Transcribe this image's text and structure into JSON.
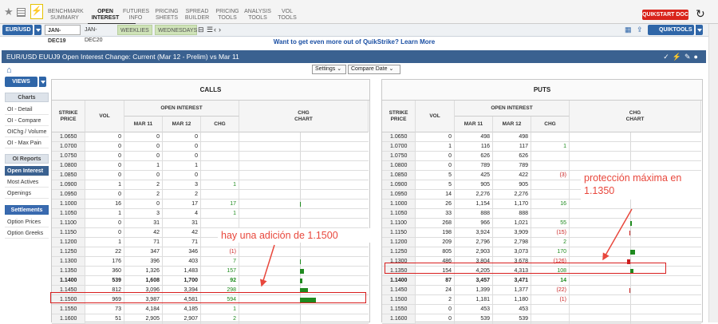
{
  "top": {
    "nav": [
      {
        "label": "BENCHMARK\nSUMMARY",
        "active": false
      },
      {
        "label": "OPEN\nINTEREST",
        "active": true
      },
      {
        "label": "FUTURES\nINFO",
        "active": false
      },
      {
        "label": "PRICING\nSHEETS",
        "active": false
      },
      {
        "label": "SPREAD\nBUILDER",
        "active": false
      },
      {
        "label": "PRICING\nTOOLS",
        "active": false
      },
      {
        "label": "ANALYSIS\nTOOLS",
        "active": false
      },
      {
        "label": "VOL\nTOOLS",
        "active": false
      }
    ],
    "quickstart": "QUIKSTART DOC"
  },
  "toolbar": {
    "product": "EUR/USD",
    "tabs": [
      {
        "label": "JAN-DEC19",
        "style": "on"
      },
      {
        "label": "JAN-DEC20",
        "style": "plain"
      },
      {
        "label": "WEEKLIES",
        "style": "green"
      },
      {
        "label": "WEDNESDAYS",
        "style": "green"
      }
    ],
    "quicktools": "QUIKTOOLS"
  },
  "promo": "Want to get even more out of QuikStrike? Learn More",
  "banner": "EUR/USD EUUJ9 Open Interest Change: Current (Mar 12 - Prelim) vs Mar 11",
  "controls": {
    "settings": "Settings",
    "compare": "Compare Date"
  },
  "sidebar": {
    "views": "VIEWS",
    "charts_header": "Charts",
    "charts": [
      "OI - Detail",
      "OI - Compare",
      "OIChg / Volume",
      "OI - Max Pain"
    ],
    "reports_header": "OI Reports",
    "reports": [
      "Open Interest",
      "Most Actives",
      "Openings"
    ],
    "settlements_header": "Settlements",
    "settlements": [
      "Option Prices",
      "Option Greeks"
    ],
    "selected": "Open Interest"
  },
  "colors": {
    "positive": "#1d8a1d",
    "negative": "#c81e1e",
    "bar": "#1f8a1f",
    "highlight": "#d81e1e",
    "annotation": "#e8473c"
  },
  "calls": {
    "title": "CALLS",
    "headers": {
      "strike": "STRIKE\nPRICE",
      "vol": "VOL",
      "oi": "OPEN INTEREST",
      "mar11": "MAR 11",
      "mar12": "MAR 12",
      "chg": "CHG",
      "chart": "CHG\nCHART"
    },
    "rows": [
      [
        "1.0650",
        "0",
        "0",
        "0",
        ""
      ],
      [
        "1.0700",
        "0",
        "0",
        "0",
        ""
      ],
      [
        "1.0750",
        "0",
        "0",
        "0",
        ""
      ],
      [
        "1.0800",
        "0",
        "1",
        "1",
        ""
      ],
      [
        "1.0850",
        "0",
        "0",
        "0",
        ""
      ],
      [
        "1.0900",
        "1",
        "2",
        "3",
        "1"
      ],
      [
        "1.0950",
        "0",
        "2",
        "2",
        ""
      ],
      [
        "1.1000",
        "16",
        "0",
        "17",
        "17"
      ],
      [
        "1.1050",
        "1",
        "3",
        "4",
        "1"
      ],
      [
        "1.1100",
        "0",
        "31",
        "31",
        ""
      ],
      [
        "1.1150",
        "0",
        "42",
        "42",
        ""
      ],
      [
        "1.1200",
        "1",
        "71",
        "71",
        ""
      ],
      [
        "1.1250",
        "22",
        "347",
        "346",
        "(1)"
      ],
      [
        "1.1300",
        "176",
        "396",
        "403",
        "7"
      ],
      [
        "1.1350",
        "360",
        "1,326",
        "1,483",
        "157"
      ],
      [
        "1.1400",
        "539",
        "1,608",
        "1,700",
        "92"
      ],
      [
        "1.1450",
        "812",
        "3,096",
        "3,394",
        "298"
      ],
      [
        "1.1500",
        "969",
        "3,987",
        "4,581",
        "594"
      ],
      [
        "1.1550",
        "73",
        "4,184",
        "4,185",
        "1"
      ],
      [
        "1.1600",
        "51",
        "2,905",
        "2,907",
        "2"
      ]
    ],
    "bold_row": "1.1400",
    "bars": {
      "1.1000": 17,
      "1.1300": 7,
      "1.1350": 157,
      "1.1400": 92,
      "1.1450": 298,
      "1.1500": 594
    }
  },
  "puts": {
    "title": "PUTS",
    "headers": {
      "strike": "STRIKE\nPRICE",
      "vol": "VOL",
      "oi": "OPEN INTEREST",
      "mar11": "MAR 11",
      "mar12": "MAR 12",
      "chg": "CHG",
      "chart": "CHG\nCHART"
    },
    "rows": [
      [
        "1.0650",
        "0",
        "498",
        "498",
        ""
      ],
      [
        "1.0700",
        "1",
        "116",
        "117",
        "1"
      ],
      [
        "1.0750",
        "0",
        "626",
        "626",
        ""
      ],
      [
        "1.0800",
        "0",
        "789",
        "789",
        ""
      ],
      [
        "1.0850",
        "5",
        "425",
        "422",
        "(3)"
      ],
      [
        "1.0900",
        "5",
        "905",
        "905",
        ""
      ],
      [
        "1.0950",
        "14",
        "2,276",
        "2,276",
        ""
      ],
      [
        "1.1000",
        "26",
        "1,154",
        "1,170",
        "16"
      ],
      [
        "1.1050",
        "33",
        "888",
        "888",
        ""
      ],
      [
        "1.1100",
        "268",
        "966",
        "1,021",
        "55"
      ],
      [
        "1.1150",
        "198",
        "3,924",
        "3,909",
        "(15)"
      ],
      [
        "1.1200",
        "209",
        "2,796",
        "2,798",
        "2"
      ],
      [
        "1.1250",
        "805",
        "2,903",
        "3,073",
        "170"
      ],
      [
        "1.1300",
        "486",
        "3,804",
        "3,678",
        "(126)"
      ],
      [
        "1.1350",
        "154",
        "4,205",
        "4,313",
        "108"
      ],
      [
        "1.1400",
        "87",
        "3,457",
        "3,471",
        "14"
      ],
      [
        "1.1450",
        "24",
        "1,399",
        "1,377",
        "(22)"
      ],
      [
        "1.1500",
        "2",
        "1,181",
        "1,180",
        "(1)"
      ],
      [
        "1.1550",
        "0",
        "453",
        "453",
        ""
      ],
      [
        "1.1600",
        "0",
        "539",
        "539",
        ""
      ]
    ],
    "bold_row": "1.1400",
    "bars": {
      "1.1100": 55,
      "1.1150": -15,
      "1.1250": 170,
      "1.1300": -126,
      "1.1350": 108,
      "1.1450": -22
    }
  },
  "annotations": {
    "calls_note": "hay una adición de 1.1500",
    "puts_note": "protección máxima en\n1.1350"
  }
}
